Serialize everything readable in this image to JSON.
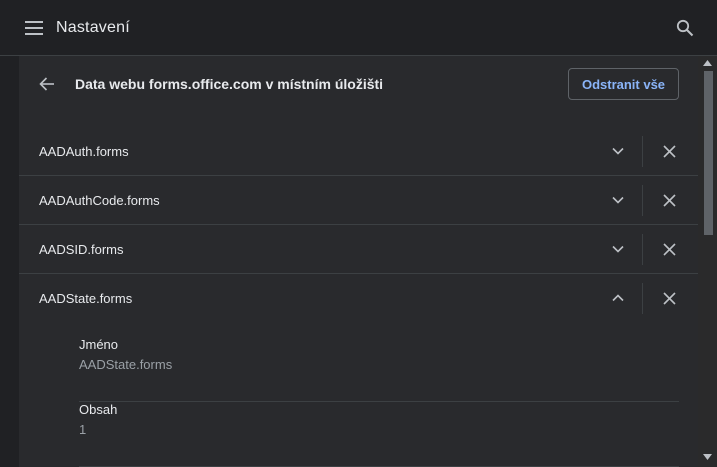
{
  "app": {
    "title": "Nastavení"
  },
  "colors": {
    "accent": "#8ab4f8",
    "background": "#202124",
    "card": "#292a2d"
  },
  "subheader": {
    "title": "Data webu forms.office.com v místním úložišti",
    "remove_all_label": "Odstranit vše"
  },
  "items": [
    {
      "label": "AADAuth.forms",
      "expanded": false
    },
    {
      "label": "AADAuthCode.forms",
      "expanded": false
    },
    {
      "label": "AADSID.forms",
      "expanded": false
    },
    {
      "label": "AADState.forms",
      "expanded": true
    }
  ],
  "details": [
    {
      "label": "Jméno",
      "value": "AADState.forms"
    },
    {
      "label": "Obsah",
      "value": "1"
    }
  ],
  "icons": {
    "menu": "menu-icon",
    "search": "search-icon",
    "back": "arrow-back-icon",
    "expand": "chevron-down-icon",
    "collapse": "chevron-up-icon",
    "delete": "close-icon"
  }
}
